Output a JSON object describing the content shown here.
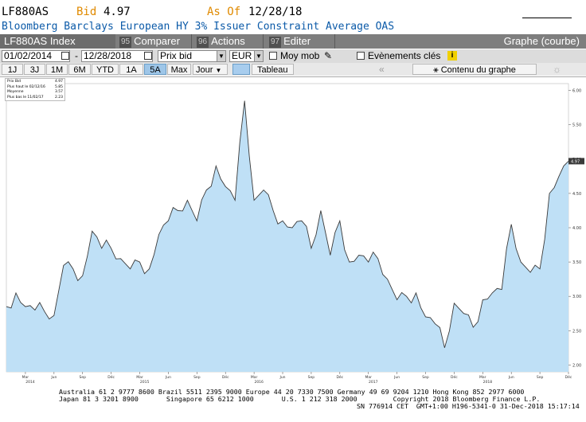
{
  "header": {
    "ticker": "LF880AS",
    "bid_label": "Bid",
    "bid_value": "4.97",
    "asof_label": "As Of",
    "asof_value": "12/28/18",
    "description": "Bloomberg Barclays European HY 3% Issuer Constraint Average OAS"
  },
  "toolbar": {
    "index_label": "LF880AS Index",
    "menus": [
      {
        "num": "95",
        "label": "Comparer"
      },
      {
        "num": "96",
        "label": "Actions"
      },
      {
        "num": "97",
        "label": "Editer"
      }
    ],
    "right_label": "Graphe (courbe)"
  },
  "controls": {
    "start_date": "01/02/2014",
    "end_date": "12/28/2018",
    "price_field": "Prix bid",
    "currency": "EUR",
    "avg_label": "Moy mob",
    "events_label": "Evènements clés",
    "info_icon": "i"
  },
  "periods": {
    "buttons": [
      "1J",
      "3J",
      "1M",
      "6M",
      "YTD",
      "1A",
      "5A",
      "Max"
    ],
    "active": "5A",
    "frequency": "Jour",
    "table_tab": "Tableau",
    "content_label": "Contenu du graphe"
  },
  "legend": {
    "rows": [
      {
        "label": "Prix Bid",
        "value": "4.97"
      },
      {
        "label": "Plus haut le 02/12/16",
        "value": "5.85"
      },
      {
        "label": "Moyenne",
        "value": "3.57"
      },
      {
        "label": "Plus bas le 11/02/17",
        "value": "2.23"
      }
    ]
  },
  "chart_data": {
    "type": "area",
    "x": [
      "2014-01",
      "2014-02",
      "2014-03",
      "2014-04",
      "2014-05",
      "2014-06",
      "2014-07",
      "2014-08",
      "2014-09",
      "2014-10",
      "2014-11",
      "2014-12",
      "2015-01",
      "2015-02",
      "2015-03",
      "2015-04",
      "2015-05",
      "2015-06",
      "2015-07",
      "2015-08",
      "2015-09",
      "2015-10",
      "2015-11",
      "2015-12",
      "2016-01",
      "2016-02",
      "2016-03",
      "2016-04",
      "2016-05",
      "2016-06",
      "2016-07",
      "2016-08",
      "2016-09",
      "2016-10",
      "2016-11",
      "2016-12",
      "2017-01",
      "2017-02",
      "2017-03",
      "2017-04",
      "2017-05",
      "2017-06",
      "2017-07",
      "2017-08",
      "2017-09",
      "2017-10",
      "2017-11",
      "2017-12",
      "2018-01",
      "2018-02",
      "2018-03",
      "2018-04",
      "2018-05",
      "2018-06",
      "2018-07",
      "2018-08",
      "2018-09",
      "2018-10",
      "2018-11",
      "2018-12"
    ],
    "series": [
      {
        "values": [
          2.85,
          3.05,
          2.85,
          2.8,
          2.78,
          2.72,
          3.45,
          3.4,
          3.3,
          3.95,
          3.7,
          3.7,
          3.55,
          3.4,
          3.5,
          3.4,
          3.9,
          4.1,
          4.25,
          4.4,
          4.1,
          4.55,
          4.9,
          4.6,
          4.4,
          5.85,
          4.4,
          4.55,
          4.25,
          4.1,
          4.0,
          4.1,
          3.7,
          4.25,
          3.6,
          4.1,
          3.5,
          3.6,
          3.5,
          3.55,
          3.25,
          2.95,
          3.0,
          3.05,
          2.7,
          2.6,
          2.25,
          2.9,
          2.75,
          2.55,
          2.95,
          3.05,
          3.1,
          4.05,
          3.5,
          3.35,
          3.4,
          4.5,
          4.75,
          4.97
        ]
      }
    ],
    "ylim": [
      1.9,
      6.1
    ],
    "yticks": [
      "2.00",
      "2.50",
      "3.00",
      "3.50",
      "4.00",
      "4.50",
      "5.00",
      "5.50",
      "6.00"
    ],
    "xticks": [
      "Mar",
      "Jun",
      "Sep",
      "Déc",
      "Mar",
      "Jun",
      "Sep",
      "Déc",
      "Mar",
      "Jun",
      "Sep",
      "Déc",
      "Mar",
      "Jun",
      "Sep",
      "Déc",
      "Mar",
      "Jun",
      "Sep",
      "Déc"
    ],
    "years": [
      "2014",
      "2015",
      "2016",
      "2017",
      "2018"
    ],
    "last_label": "4.97",
    "fill_color": "#bfe0f6",
    "line_color": "#3a3a3a"
  },
  "footer": {
    "line1": "Australia 61 2 9777 8600 Brazil 5511 2395 9000 Europe 44 20 7330 7500 Germany 49 69 9204 1210 Hong Kong 852 2977 6000",
    "line2": "Japan 81 3 3201 8900       Singapore 65 6212 1000       U.S. 1 212 318 2000         Copyright 2018 Bloomberg Finance L.P.",
    "line3": "SN 776914 CET  GMT+1:00 H196-5341-0 31-Dec-2018 15:17:14"
  }
}
